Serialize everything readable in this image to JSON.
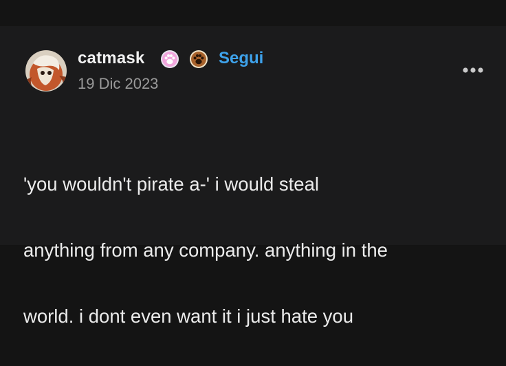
{
  "post": {
    "author": {
      "username": "catmask",
      "avatar_icon": "cat-mask-avatar-icon",
      "badges": [
        {
          "icon": "pink-paw-badge-icon",
          "color": "#f2a6dd"
        },
        {
          "icon": "brown-paw-badge-icon",
          "color": "#a8622b"
        }
      ]
    },
    "follow_label": "Segui",
    "date": "19 Dic 2023",
    "menu_icon": "more-options-icon",
    "body_lines": [
      "'you wouldn't pirate a-' i would steal",
      "anything from any company. anything in the",
      "world. i dont even want it i just hate you"
    ]
  },
  "colors": {
    "background": "#141414",
    "card": "#1b1b1c",
    "text": "#ebebeb",
    "muted": "#9a9a9a",
    "accent": "#3ea2ea"
  }
}
